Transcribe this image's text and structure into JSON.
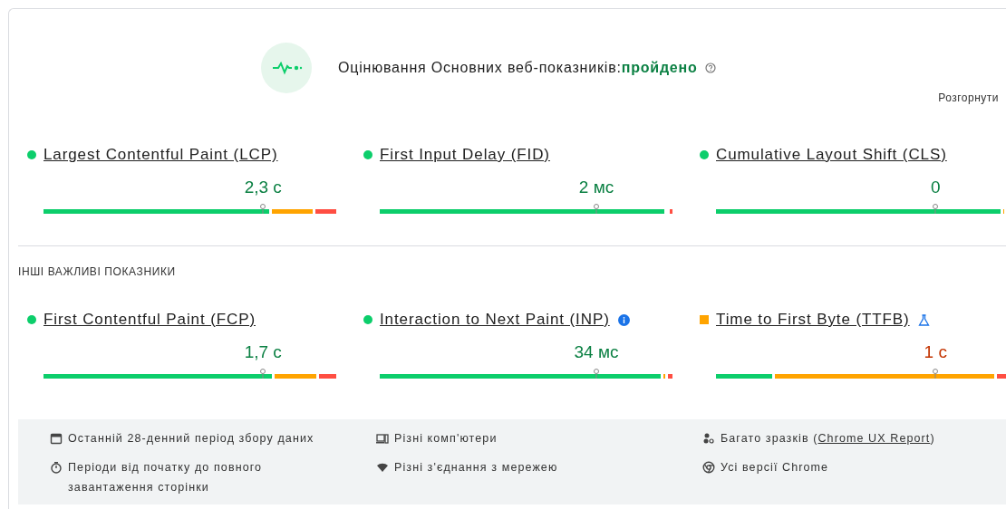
{
  "assessment": {
    "title": "Оцінювання Основних веб-показників:",
    "result": "пройдено",
    "passed": true,
    "expand": "Розгорнути"
  },
  "core_metrics": [
    {
      "name": "Largest Contentful Paint (LCP)",
      "kind": "dot",
      "color": "#0cce6b",
      "value": "2,3 с",
      "marker": {
        "level": 0.75
      },
      "distribution": [
        {
          "kind": "average",
          "level": 0.93
        },
        {
          "kind": "good",
          "level": 0.78
        }
      ]
    },
    {
      "name": "First Input Delay (FID)",
      "kind": "dot",
      "color": "#0cce6b",
      "value": "2 мс",
      "marker": {
        "level": 0.74
      },
      "distribution": [
        {
          "kind": "average",
          "level": 0.99
        },
        {
          "kind": "good",
          "level": 0.98
        }
      ]
    },
    {
      "name": "Cumulative Layout Shift (CLS)",
      "kind": "dot",
      "color": "#0cce6b",
      "value": "0",
      "marker": {
        "level": 0.75
      },
      "distribution": [
        {
          "kind": "average",
          "level": 0.995
        },
        {
          "kind": "good",
          "level": 0.98
        }
      ]
    }
  ],
  "other_section": {
    "heading": "ІНШІ ВАЖЛИВІ ПОКАЗНИКИ"
  },
  "other_metrics": [
    {
      "name": "First Contentful Paint (FCP)",
      "kind": "dot",
      "color": "#0cce6b",
      "value": "1,7 с",
      "marker": {
        "level": 0.75
      },
      "distribution": [
        {
          "kind": "average",
          "level": 0.94
        },
        {
          "kind": "good",
          "level": 0.79
        }
      ]
    },
    {
      "name": "Interaction to Next Paint (INP)",
      "kind": "dot",
      "color": "#0cce6b",
      "info": true,
      "value": "34 мс",
      "marker": {
        "level": 0.74
      },
      "distribution": [
        {
          "kind": "average",
          "level": 0.985
        },
        {
          "kind": "good",
          "level": 0.97
        }
      ]
    },
    {
      "name": "Time to First Byte (TTFB)",
      "kind": "square",
      "color": "#ffa400",
      "experimental": true,
      "value": "1 с",
      "marker": {
        "level": 0.75
      },
      "distribution": [
        {
          "kind": "average",
          "level": 0.96
        },
        {
          "kind": "good",
          "level": 0.2
        }
      ]
    }
  ],
  "footer": [
    {
      "text": "Останній 28-денний період збору даних"
    },
    {
      "text": "Різні комп'ютери"
    },
    {
      "text": "Багато зразків (",
      "link": "Chrome UX Report",
      "text_after": ")"
    },
    {
      "text": "Періоди від початку до повного завантаження сторінки"
    },
    {
      "text": "Різні з'єднання з мережею"
    },
    {
      "text": "Усі версії Chrome"
    }
  ]
}
